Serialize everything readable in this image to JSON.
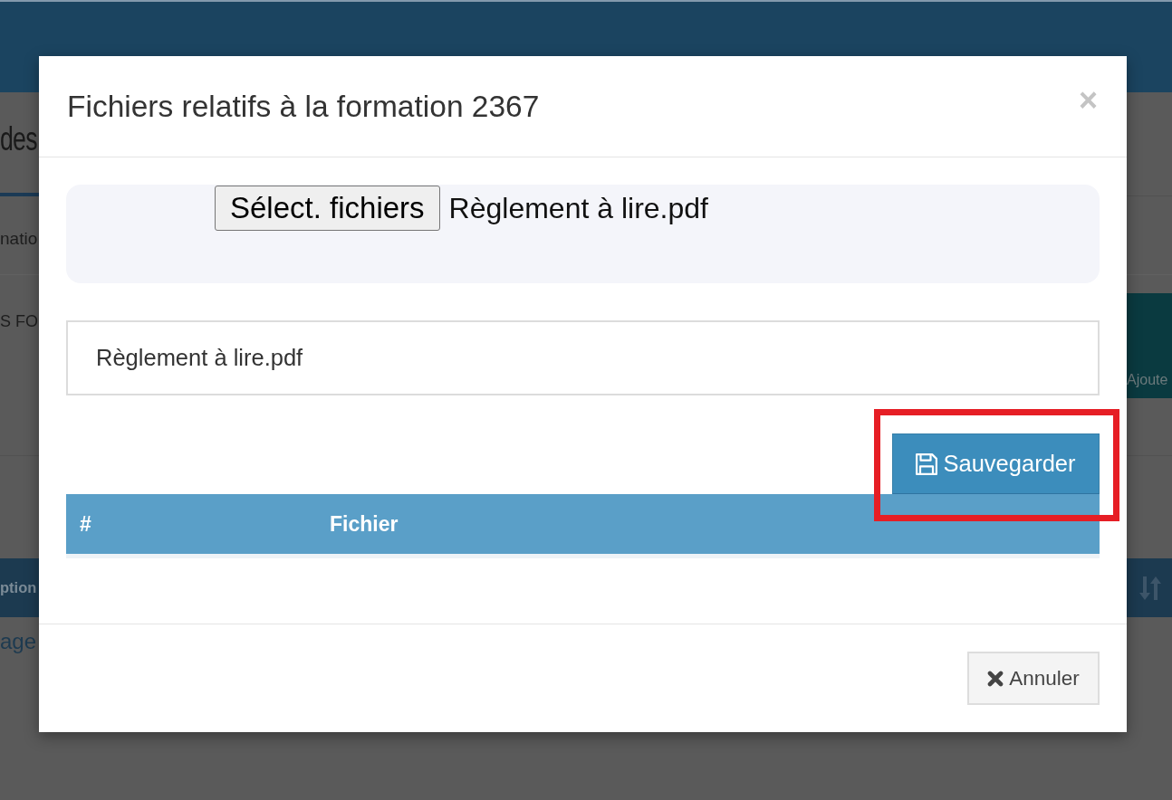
{
  "background_page": {
    "heading": "des",
    "line_1": "natio",
    "line_2": "S FO",
    "button": "Ajoute",
    "table_column": "ption",
    "link": "age"
  },
  "modal": {
    "title": "Fichiers relatifs à la formation 2367",
    "close": "×",
    "file_input": {
      "button": "Sélect. fichiers",
      "value": "Règlement à lire.pdf"
    },
    "file_list": [
      "Règlement à lire.pdf"
    ],
    "save_button": {
      "label": "Sauvegarder",
      "highlighted": true
    },
    "table": {
      "columns": [
        "#",
        "Fichier"
      ]
    },
    "cancel_button": {
      "label": "Annuler"
    }
  }
}
